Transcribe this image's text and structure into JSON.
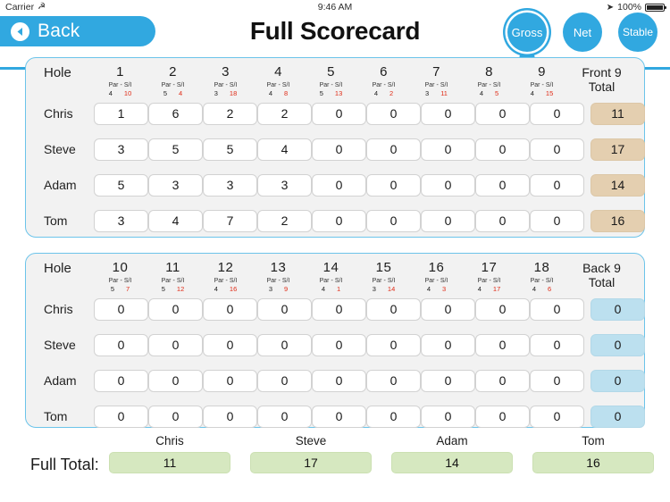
{
  "status_bar": {
    "carrier": "Carrier",
    "wifi_icon": "wifi-icon",
    "time": "9:46 AM",
    "location_icon": "location-arrow-icon",
    "battery_percent": "100%"
  },
  "nav": {
    "back_label": "Back",
    "back_icon": "chevron-left-icon",
    "title": "Full Scorecard",
    "modes": [
      {
        "label": "Gross",
        "selected": true
      },
      {
        "label": "Net",
        "selected": false
      },
      {
        "label": "Stable",
        "selected": false
      }
    ],
    "accent_color": "#31a8e0"
  },
  "labels": {
    "hole": "Hole",
    "par": "Par",
    "separator": "-",
    "si": "S/I",
    "front_total": "Front 9\nTotal",
    "front_total_line1": "Front 9",
    "front_total_line2": "Total",
    "back_total_line1": "Back 9",
    "back_total_line2": "Total",
    "full_total": "Full Total:"
  },
  "players": [
    "Chris",
    "Steve",
    "Adam",
    "Tom"
  ],
  "front_nine": {
    "holes": [
      "1",
      "2",
      "3",
      "4",
      "5",
      "6",
      "7",
      "8",
      "9"
    ],
    "par": [
      "4",
      "5",
      "3",
      "4",
      "5",
      "4",
      "3",
      "4",
      "4"
    ],
    "si": [
      "10",
      "4",
      "18",
      "8",
      "13",
      "2",
      "11",
      "5",
      "15"
    ],
    "scores": [
      {
        "player": "Chris",
        "values": [
          "1",
          "6",
          "2",
          "2",
          "0",
          "0",
          "0",
          "0",
          "0"
        ],
        "total": "11"
      },
      {
        "player": "Steve",
        "values": [
          "3",
          "5",
          "5",
          "4",
          "0",
          "0",
          "0",
          "0",
          "0"
        ],
        "total": "17"
      },
      {
        "player": "Adam",
        "values": [
          "5",
          "3",
          "3",
          "3",
          "0",
          "0",
          "0",
          "0",
          "0"
        ],
        "total": "14"
      },
      {
        "player": "Tom",
        "values": [
          "3",
          "4",
          "7",
          "2",
          "0",
          "0",
          "0",
          "0",
          "0"
        ],
        "total": "16"
      }
    ],
    "total_color": "#e4cfb0"
  },
  "back_nine": {
    "holes": [
      "10",
      "11",
      "12",
      "13",
      "14",
      "15",
      "16",
      "17",
      "18"
    ],
    "par": [
      "5",
      "5",
      "4",
      "3",
      "4",
      "3",
      "4",
      "4",
      "4"
    ],
    "si": [
      "7",
      "12",
      "16",
      "9",
      "1",
      "14",
      "3",
      "17",
      "6"
    ],
    "scores": [
      {
        "player": "Chris",
        "values": [
          "0",
          "0",
          "0",
          "0",
          "0",
          "0",
          "0",
          "0",
          "0"
        ],
        "total": "0"
      },
      {
        "player": "Steve",
        "values": [
          "0",
          "0",
          "0",
          "0",
          "0",
          "0",
          "0",
          "0",
          "0"
        ],
        "total": "0"
      },
      {
        "player": "Adam",
        "values": [
          "0",
          "0",
          "0",
          "0",
          "0",
          "0",
          "0",
          "0",
          "0"
        ],
        "total": "0"
      },
      {
        "player": "Tom",
        "values": [
          "0",
          "0",
          "0",
          "0",
          "0",
          "0",
          "0",
          "0",
          "0"
        ],
        "total": "0"
      }
    ],
    "total_color": "#bce0ef"
  },
  "full_totals": [
    {
      "player": "Chris",
      "total": "11"
    },
    {
      "player": "Steve",
      "total": "17"
    },
    {
      "player": "Adam",
      "total": "14"
    },
    {
      "player": "Tom",
      "total": "16"
    }
  ],
  "full_total_color": "#d6e8c0"
}
